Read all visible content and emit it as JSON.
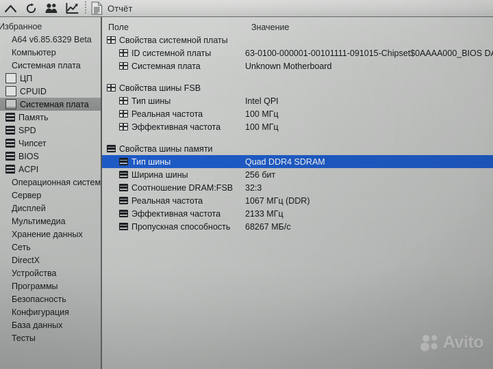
{
  "toolbar": {
    "buttons": [
      {
        "icon": "chevron-up-icon",
        "name": "up-button"
      },
      {
        "icon": "refresh-icon",
        "name": "refresh-button"
      },
      {
        "icon": "users-icon",
        "name": "users-button"
      },
      {
        "icon": "chart-icon",
        "name": "chart-button"
      }
    ],
    "report": {
      "icon": "document-icon",
      "label": "Отчёт"
    }
  },
  "sidebar": {
    "header": "Избранное",
    "items": [
      {
        "label": "A64 v6.85.6329 Beta",
        "level": 0,
        "icon": "none",
        "selected": false
      },
      {
        "label": "Компьютер",
        "level": 0,
        "icon": "none",
        "selected": false
      },
      {
        "label": "Системная плата",
        "level": 0,
        "icon": "none",
        "selected": false
      },
      {
        "label": "ЦП",
        "level": 1,
        "icon": "blank",
        "selected": false
      },
      {
        "label": "CPUID",
        "level": 1,
        "icon": "blank",
        "selected": false
      },
      {
        "label": "Системная плата",
        "level": 1,
        "icon": "board",
        "selected": true
      },
      {
        "label": "Память",
        "level": 1,
        "icon": "chip",
        "selected": false
      },
      {
        "label": "SPD",
        "level": 1,
        "icon": "chip",
        "selected": false
      },
      {
        "label": "Чипсет",
        "level": 1,
        "icon": "chip",
        "selected": false
      },
      {
        "label": "BIOS",
        "level": 1,
        "icon": "chip",
        "selected": false
      },
      {
        "label": "ACPI",
        "level": 1,
        "icon": "chip",
        "selected": false
      },
      {
        "label": "Операционная система",
        "level": 0,
        "icon": "none",
        "selected": false
      },
      {
        "label": "Сервер",
        "level": 0,
        "icon": "none",
        "selected": false
      },
      {
        "label": "Дисплей",
        "level": 0,
        "icon": "none",
        "selected": false
      },
      {
        "label": "Мультимедиа",
        "level": 0,
        "icon": "none",
        "selected": false
      },
      {
        "label": "Хранение данных",
        "level": 0,
        "icon": "none",
        "selected": false
      },
      {
        "label": "Сеть",
        "level": 0,
        "icon": "none",
        "selected": false
      },
      {
        "label": "DirectX",
        "level": 0,
        "icon": "none",
        "selected": false
      },
      {
        "label": "Устройства",
        "level": 0,
        "icon": "none",
        "selected": false
      },
      {
        "label": "Программы",
        "level": 0,
        "icon": "none",
        "selected": false
      },
      {
        "label": "Безопасность",
        "level": 0,
        "icon": "none",
        "selected": false
      },
      {
        "label": "Конфигурация",
        "level": 0,
        "icon": "none",
        "selected": false
      },
      {
        "label": "База данных",
        "level": 0,
        "icon": "none",
        "selected": false
      },
      {
        "label": "Тесты",
        "level": 0,
        "icon": "none",
        "selected": false
      }
    ]
  },
  "main": {
    "columns": {
      "field": "Поле",
      "value": "Значение"
    },
    "rows": [
      {
        "type": "group",
        "icon": "grid",
        "field": "Свойства системной платы",
        "value": ""
      },
      {
        "type": "item",
        "icon": "grid",
        "field": "ID системной платы",
        "value": "63-0100-000001-00101111-091015-Chipset$0AAAA000_BIOS DA"
      },
      {
        "type": "item",
        "icon": "grid",
        "field": "Системная плата",
        "value": "Unknown Motherboard"
      },
      {
        "type": "spacer"
      },
      {
        "type": "group",
        "icon": "grid",
        "field": "Свойства шины FSB",
        "value": ""
      },
      {
        "type": "item",
        "icon": "grid",
        "field": "Тип шины",
        "value": "Intel QPI"
      },
      {
        "type": "item",
        "icon": "grid",
        "field": "Реальная частота",
        "value": "100 МГц"
      },
      {
        "type": "item",
        "icon": "grid",
        "field": "Эффективная частота",
        "value": "100 МГц"
      },
      {
        "type": "spacer"
      },
      {
        "type": "group",
        "icon": "mem",
        "field": "Свойства шины памяти",
        "value": ""
      },
      {
        "type": "item",
        "icon": "mem",
        "field": "Тип шины",
        "value": "Quad DDR4 SDRAM",
        "selected": true
      },
      {
        "type": "item",
        "icon": "mem",
        "field": "Ширина шины",
        "value": "256 бит"
      },
      {
        "type": "item",
        "icon": "mem",
        "field": "Соотношение DRAM:FSB",
        "value": "32:3"
      },
      {
        "type": "item",
        "icon": "mem",
        "field": "Реальная частота",
        "value": "1067 МГц (DDR)"
      },
      {
        "type": "item",
        "icon": "mem",
        "field": "Эффективная частота",
        "value": "2133 МГц"
      },
      {
        "type": "item",
        "icon": "mem",
        "field": "Пропускная способность",
        "value": "68267 МБ/с"
      }
    ]
  },
  "watermark": {
    "text": "Avito",
    "logo": "avito-dots-logo"
  },
  "colors": {
    "selection_blue": "#1f5fcf",
    "sidebar_selection": "#9b9e9c",
    "panel_bg": "#d0d2d0",
    "text": "#14171a"
  }
}
